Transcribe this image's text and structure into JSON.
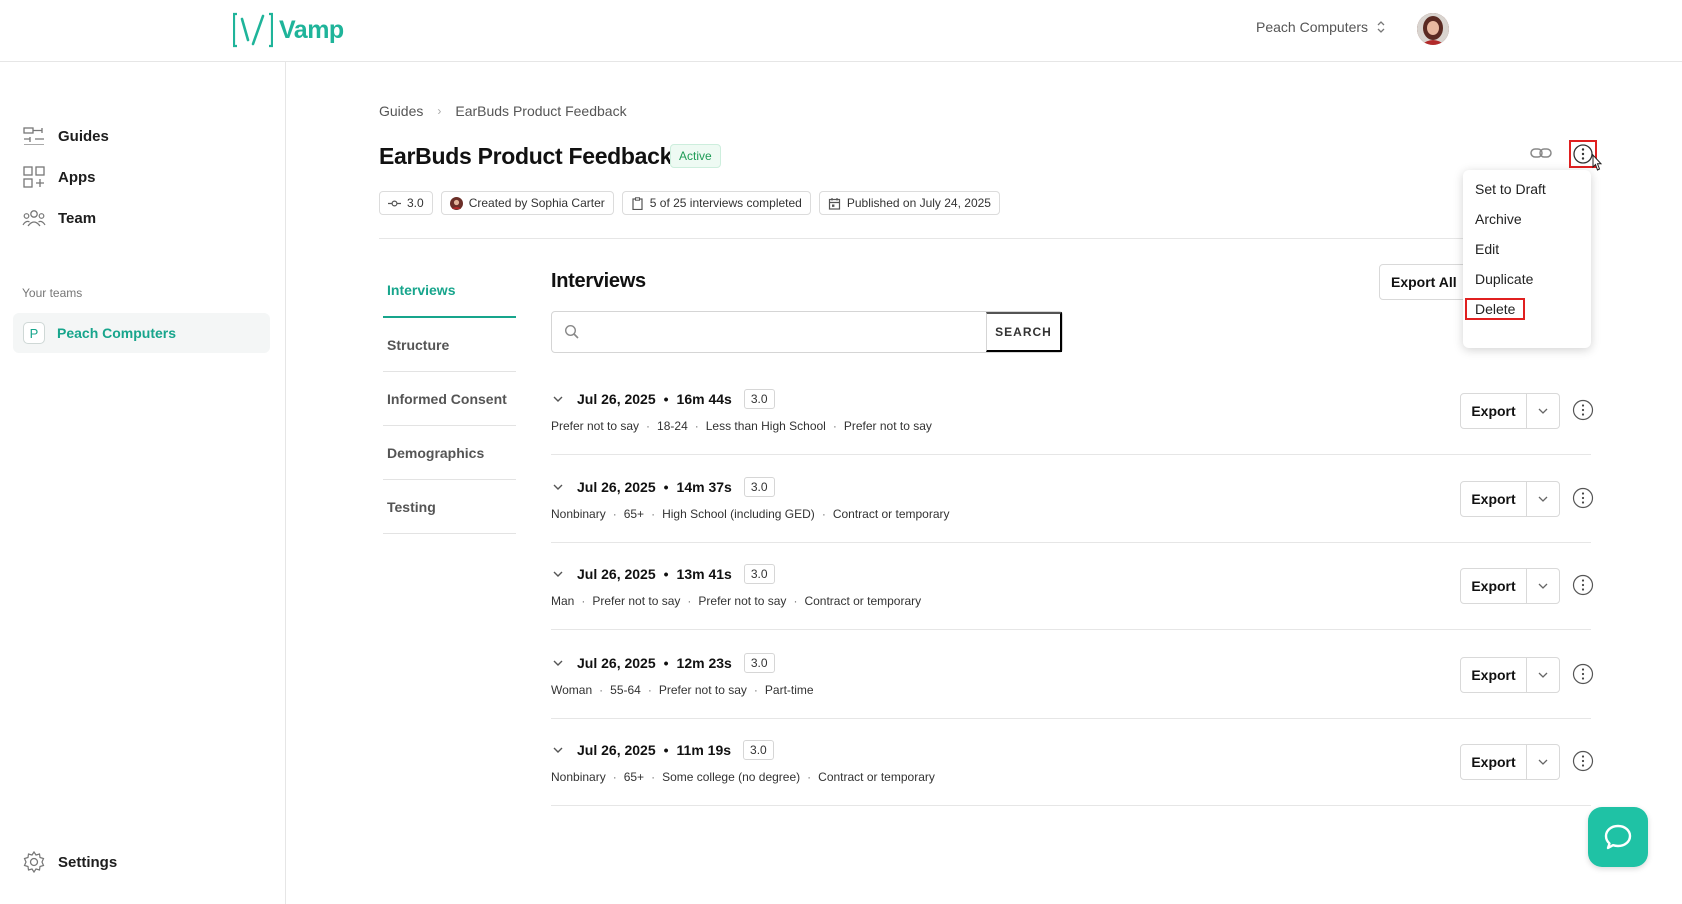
{
  "app": {
    "name": "Vamp",
    "brand_color": "#1fb49a"
  },
  "topbar": {
    "org_name": "Peach Computers"
  },
  "sidebar": {
    "items": [
      {
        "label": "Guides",
        "icon": "guides-icon"
      },
      {
        "label": "Apps",
        "icon": "apps-icon"
      },
      {
        "label": "Team",
        "icon": "team-icon"
      }
    ],
    "teams_label": "Your teams",
    "team": {
      "badge": "P",
      "name": "Peach Computers"
    },
    "settings_label": "Settings"
  },
  "breadcrumb": {
    "root": "Guides",
    "current": "EarBuds Product Feedback"
  },
  "guide": {
    "title": "EarBuds Product Feedback",
    "status": "Active",
    "version": "3.0",
    "created_by": "Created by Sophia Carter",
    "progress": "5 of 25 interviews completed",
    "published": "Published on July 24, 2025"
  },
  "tabs": [
    "Interviews",
    "Structure",
    "Informed Consent",
    "Demographics",
    "Testing"
  ],
  "interviews": {
    "title": "Interviews",
    "export_all": "Export All",
    "search_placeholder": "",
    "search_button": "SEARCH",
    "export_label": "Export",
    "rows": [
      {
        "date": "Jul 26, 2025",
        "duration": "16m 44s",
        "version": "3.0",
        "demo": [
          "Prefer not to say",
          "18-24",
          "Less than High School",
          "Prefer not to say"
        ]
      },
      {
        "date": "Jul 26, 2025",
        "duration": "14m 37s",
        "version": "3.0",
        "demo": [
          "Nonbinary",
          "65+",
          "High School (including GED)",
          "Contract or temporary"
        ]
      },
      {
        "date": "Jul 26, 2025",
        "duration": "13m 41s",
        "version": "3.0",
        "demo": [
          "Man",
          "Prefer not to say",
          "Prefer not to say",
          "Contract or temporary"
        ]
      },
      {
        "date": "Jul 26, 2025",
        "duration": "12m 23s",
        "version": "3.0",
        "demo": [
          "Woman",
          "55-64",
          "Prefer not to say",
          "Part-time"
        ]
      },
      {
        "date": "Jul 26, 2025",
        "duration": "11m 19s",
        "version": "3.0",
        "demo": [
          "Nonbinary",
          "65+",
          "Some college (no degree)",
          "Contract or temporary"
        ]
      }
    ]
  },
  "menu": {
    "items": [
      "Set to Draft",
      "Archive",
      "Edit",
      "Duplicate",
      "Delete"
    ]
  }
}
